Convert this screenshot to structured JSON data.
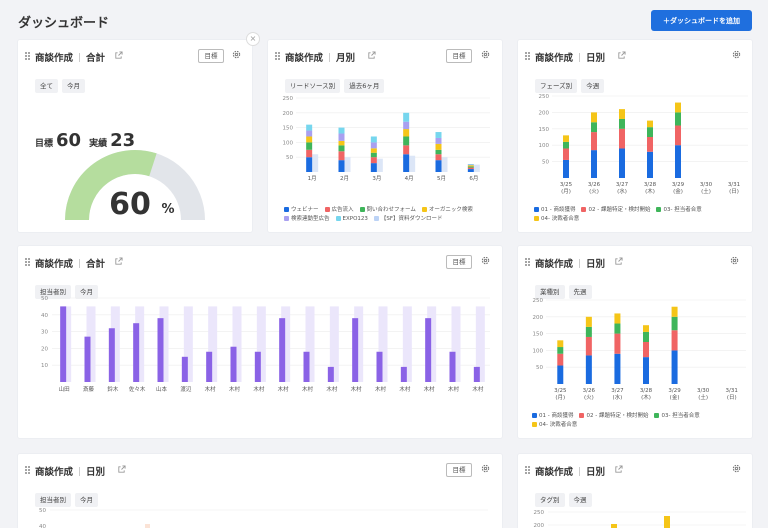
{
  "page": {
    "title": "ダッシュボード",
    "add_button": "＋ダッシュボードを追加"
  },
  "colors": {
    "blue": "#1a6be0",
    "red": "#f06464",
    "green": "#3fb55a",
    "yellow": "#f5c518",
    "purple": "#8c6cf0",
    "lilac": "#a9a0f0",
    "cyan": "#76d6ee",
    "lightblue": "#bcd3f6",
    "gauge_fill": "#b5dd9e",
    "gauge_bg": "#e2e5ea",
    "bar_purple": "#8a62e6",
    "bar_purple_bg": "#ebe6fb"
  },
  "cards": {
    "c1": {
      "title": "商談作成",
      "subtitle": "合計",
      "goal_label": "目標",
      "chips": [
        "全て",
        "今月"
      ],
      "target_label": "目標",
      "target_value": "60",
      "actual_label": "実績",
      "actual_value": "23",
      "gauge": {
        "value": "60",
        "unit": "%",
        "fraction": 0.6
      },
      "close": "×"
    },
    "c2": {
      "title": "商談作成",
      "subtitle": "月別",
      "goal_label": "目標",
      "chips": [
        "リードソース別",
        "過去6ヶ月"
      ],
      "chart_data": {
        "type": "bar",
        "stacked": true,
        "categories": [
          "1月",
          "2月",
          "3月",
          "4月",
          "5月",
          "6月"
        ],
        "yticks": [
          50,
          100,
          150,
          200,
          250
        ],
        "ylim": [
          0,
          250
        ],
        "series": [
          {
            "name": "ウェビナー",
            "color": "#1a6be0",
            "values": [
              50,
              40,
              30,
              60,
              40,
              10
            ]
          },
          {
            "name": "広告流入",
            "color": "#f06464",
            "values": [
              25,
              30,
              20,
              30,
              20,
              5
            ]
          },
          {
            "name": "問い合わせフォーム",
            "color": "#3fb55a",
            "values": [
              25,
              20,
              15,
              30,
              15,
              4
            ]
          },
          {
            "name": "オーガニック検索",
            "color": "#f5c518",
            "values": [
              20,
              15,
              15,
              25,
              20,
              4
            ]
          },
          {
            "name": "検索連動型広告",
            "color": "#a9a0f0",
            "values": [
              20,
              25,
              20,
              25,
              20,
              2
            ]
          },
          {
            "name": "EXPO123",
            "color": "#76d6ee",
            "values": [
              20,
              20,
              20,
              30,
              20,
              2
            ]
          },
          {
            "name": "【SF】資料ダウンロード",
            "color": "#bcd3f6",
            "values": [
              0,
              0,
              0,
              0,
              0,
              0
            ]
          }
        ],
        "secondary_values": [
          60,
          50,
          45,
          55,
          50,
          25
        ]
      }
    },
    "c3": {
      "title": "商談作成",
      "subtitle": "日別",
      "chips": [
        "フェーズ別",
        "今週"
      ],
      "chart_data": {
        "type": "bar",
        "stacked": true,
        "categories": [
          "3/25\n(月)",
          "3/26\n(火)",
          "3/27\n(水)",
          "3/28\n(木)",
          "3/29\n(金)",
          "3/30\n(土)",
          "3/31\n(日)"
        ],
        "yticks": [
          50,
          100,
          150,
          200,
          250
        ],
        "ylim": [
          0,
          250
        ],
        "series": [
          {
            "name": "01 - 商談獲得",
            "color": "#1a6be0",
            "values": [
              55,
              85,
              90,
              80,
              100,
              0,
              0
            ]
          },
          {
            "name": "02 - 課題特定・検討開始",
            "color": "#f06464",
            "values": [
              35,
              55,
              60,
              45,
              60,
              0,
              0
            ]
          },
          {
            "name": "03- 担当者合意",
            "color": "#3fb55a",
            "values": [
              20,
              30,
              30,
              30,
              40,
              0,
              0
            ]
          },
          {
            "name": "04- 決裁者合意",
            "color": "#f5c518",
            "values": [
              20,
              30,
              30,
              20,
              30,
              0,
              0
            ]
          }
        ]
      }
    },
    "c4": {
      "title": "商談作成",
      "subtitle": "合計",
      "goal_label": "目標",
      "chips": [
        "担当者別",
        "今月"
      ],
      "chart_data": {
        "type": "bar",
        "categories": [
          "山田",
          "斎藤",
          "鈴木",
          "佐々木",
          "山本",
          "渡辺",
          "木村",
          "木村",
          "木村",
          "木村",
          "木村",
          "木村",
          "木村",
          "木村",
          "木村",
          "木村",
          "木村",
          "木村"
        ],
        "values": [
          45,
          27,
          32,
          35,
          38,
          15,
          18,
          21,
          18,
          38,
          18,
          9,
          38,
          18,
          9,
          38,
          18,
          9
        ],
        "target": 45,
        "yticks": [
          10,
          20,
          30,
          40,
          50
        ],
        "ylim": [
          0,
          50
        ]
      }
    },
    "c5": {
      "title": "商談作成",
      "subtitle": "日別",
      "chips": [
        "業種別",
        "先週"
      ],
      "chart_data": {
        "type": "bar",
        "stacked": true,
        "categories": [
          "3/25\n(月)",
          "3/26\n(火)",
          "3/27\n(水)",
          "3/28\n(木)",
          "3/29\n(金)",
          "3/30\n(土)",
          "3/31\n(日)"
        ],
        "yticks": [
          50,
          100,
          150,
          200,
          250
        ],
        "ylim": [
          0,
          250
        ],
        "series": [
          {
            "name": "01 - 商談獲得",
            "color": "#1a6be0",
            "values": [
              55,
              85,
              90,
              80,
              100,
              0,
              0
            ]
          },
          {
            "name": "02 - 課題特定・検討開始",
            "color": "#f06464",
            "values": [
              35,
              55,
              60,
              45,
              60,
              0,
              0
            ]
          },
          {
            "name": "03- 担当者合意",
            "color": "#3fb55a",
            "values": [
              20,
              30,
              30,
              30,
              40,
              0,
              0
            ]
          },
          {
            "name": "04- 決裁者合意",
            "color": "#f5c518",
            "values": [
              20,
              30,
              30,
              20,
              30,
              0,
              0
            ]
          }
        ]
      }
    },
    "c6": {
      "title": "商談作成",
      "subtitle": "日別",
      "goal_label": "目標",
      "chips": [
        "担当者別",
        "今月"
      ],
      "yticks": [
        "50",
        "40"
      ]
    },
    "c7": {
      "title": "商談作成",
      "subtitle": "日別",
      "chips": [
        "タグ別",
        "今週"
      ],
      "yticks": [
        "250",
        "200"
      ]
    }
  }
}
